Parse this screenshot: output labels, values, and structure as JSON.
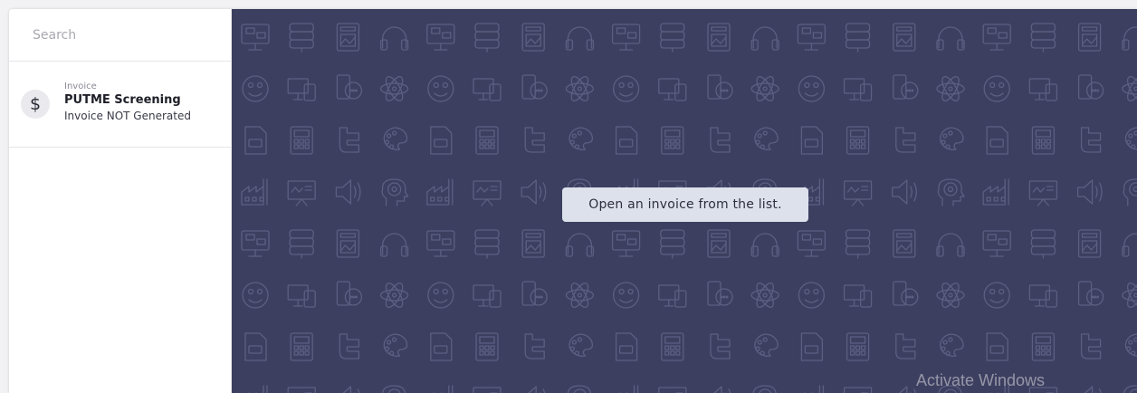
{
  "search": {
    "placeholder": "Search"
  },
  "invoice_list": [
    {
      "label": "Invoice",
      "title": "PUTME Screening",
      "status": "Invoice NOT Generated"
    }
  ],
  "main": {
    "message": "Open an invoice from the list."
  },
  "watermark": "Activate Windows",
  "icons": {
    "row_pattern": [
      [
        "monitor",
        "server",
        "document-image",
        "headphones"
      ],
      [
        "smiley",
        "devices",
        "chat-phone",
        "atom"
      ],
      [
        "jpg-file",
        "calculator",
        "twitter",
        "palette"
      ],
      [
        "factory",
        "presentation",
        "speaker",
        "brain"
      ]
    ]
  },
  "colors": {
    "background_pattern": "#3d3f60",
    "icon_stroke": "#5c5f82",
    "toast_bg": "#dde1eb"
  }
}
